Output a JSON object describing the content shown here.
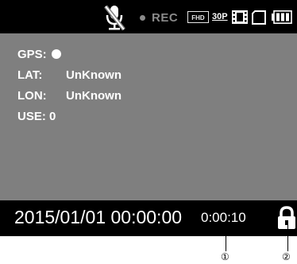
{
  "status_bar": {
    "rec_label": "REC",
    "resolution_badge": "FHD",
    "fps_badge": "30P",
    "icons": [
      "mic-muted-icon",
      "rec-dot-icon",
      "film-icon",
      "sd-card-icon",
      "battery-icon"
    ]
  },
  "gps_info": {
    "gps_label": "GPS:",
    "lat_label": "LAT:",
    "lat_value": "UnKnown",
    "lon_label": "LON:",
    "lon_value": "UnKnown",
    "use_label": "USE: 0"
  },
  "footer": {
    "datetime": "2015/01/01 00:00:00",
    "elapsed": "0:00:10",
    "lock_icon": "lock-icon"
  },
  "callouts": [
    "①",
    "②"
  ],
  "colors": {
    "screen_bg": "#7f7f7f",
    "bar_bg": "#000000",
    "rec_gray": "#8a8a8a",
    "text_white": "#ffffff"
  }
}
